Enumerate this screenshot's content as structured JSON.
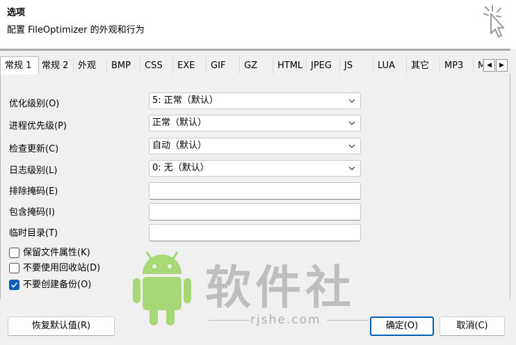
{
  "header": {
    "title": "选项",
    "subtitle": "配置 FileOptimizer 的外观和行为",
    "icon": "sparkle-cursor-icon"
  },
  "tabs": [
    {
      "label": "常规 1",
      "active": true
    },
    {
      "label": "常规 2"
    },
    {
      "label": "外观"
    },
    {
      "label": "BMP"
    },
    {
      "label": "CSS"
    },
    {
      "label": "EXE"
    },
    {
      "label": "GIF"
    },
    {
      "label": "GZ"
    },
    {
      "label": "HTML"
    },
    {
      "label": "JPEG"
    },
    {
      "label": "JS"
    },
    {
      "label": "LUA"
    },
    {
      "label": "其它"
    },
    {
      "label": "MP3"
    },
    {
      "label": "M"
    }
  ],
  "tab_scroll": {
    "left": "◀",
    "right": "▶"
  },
  "fields": {
    "opt_level": {
      "label": "优化级别(O)",
      "value": "5: 正常（默认）"
    },
    "priority": {
      "label": "进程优先级(P)",
      "value": "正常（默认）"
    },
    "update": {
      "label": "检查更新(C)",
      "value": "自动（默认）"
    },
    "log_level": {
      "label": "日志级别(L)",
      "value": "0: 无（默认）"
    },
    "exclude_mask": {
      "label": "排除掩码(E)",
      "value": ""
    },
    "include_mask": {
      "label": "包含掩码(I)",
      "value": ""
    },
    "temp_dir": {
      "label": "临时目录(T)",
      "value": ""
    }
  },
  "checkboxes": {
    "keep_attrs": {
      "label": "保留文件属性(K)",
      "checked": false
    },
    "no_recycle": {
      "label": "不要使用回收站(D)",
      "checked": false
    },
    "no_backup": {
      "label": "不要创建备份(O)",
      "checked": true
    }
  },
  "buttons": {
    "restore": "恢复默认值(R)",
    "ok": "确定(O)",
    "cancel": "取消(C)"
  },
  "watermark": {
    "brand": "软件社",
    "url": "rjshe.com",
    "icon": "android-robot-icon"
  },
  "colors": {
    "accent": "#005fb8",
    "watermark_green": "#8fd14f"
  }
}
